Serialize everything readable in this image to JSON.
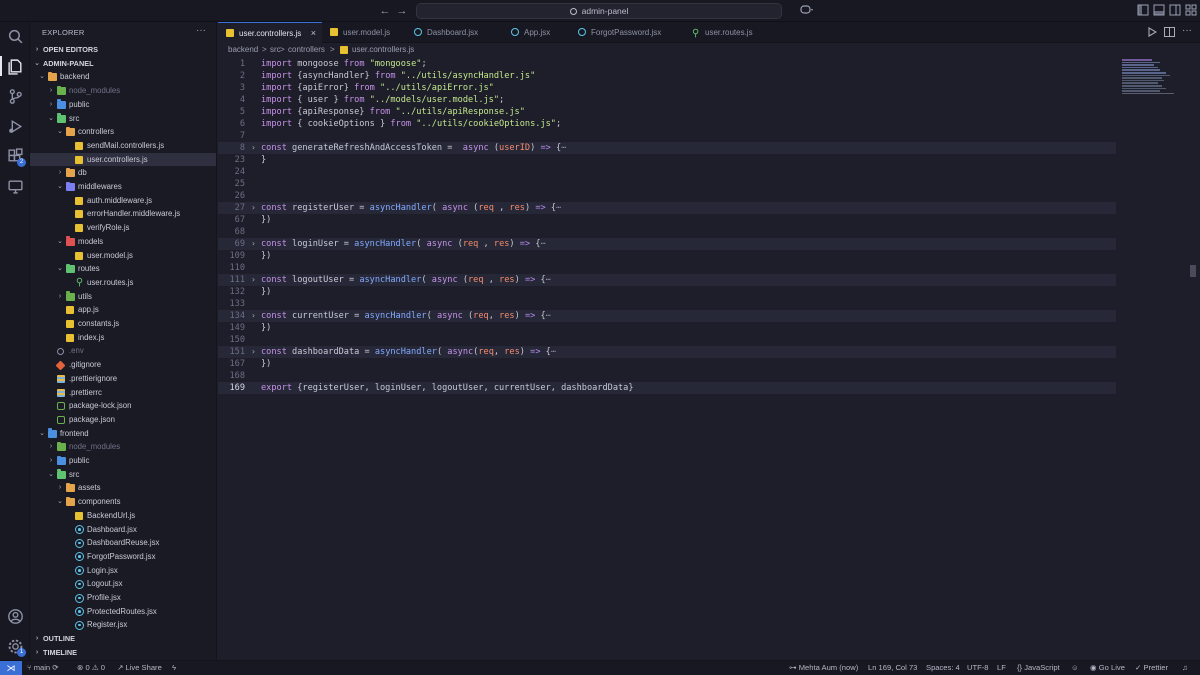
{
  "titlebar": {
    "search_text": "admin-panel",
    "nav_back": "←",
    "nav_forward": "→"
  },
  "explorer": {
    "title": "EXPLORER",
    "more": "···",
    "open_editors": "OPEN EDITORS",
    "root": "ADMIN-PANEL",
    "outline": "OUTLINE",
    "timeline": "TIMELINE",
    "tree": [
      {
        "label": "backend",
        "depth": 0,
        "chev": "v",
        "icon": "folder",
        "color": "#e5a44a"
      },
      {
        "label": "node_modules",
        "depth": 1,
        "chev": ">",
        "icon": "folder",
        "color": "#6ab04c",
        "dim": true
      },
      {
        "label": "public",
        "depth": 1,
        "chev": ">",
        "icon": "folder",
        "color": "#4b8fe0"
      },
      {
        "label": "src",
        "depth": 1,
        "chev": "v",
        "icon": "folder",
        "color": "#5ec270"
      },
      {
        "label": "controllers",
        "depth": 2,
        "chev": "v",
        "icon": "folder",
        "color": "#e5a44a"
      },
      {
        "label": "sendMail.controllers.js",
        "depth": 3,
        "icon": "js"
      },
      {
        "label": "user.controllers.js",
        "depth": 3,
        "icon": "js",
        "selected": true
      },
      {
        "label": "db",
        "depth": 2,
        "chev": ">",
        "icon": "folder",
        "color": "#e5a44a"
      },
      {
        "label": "middlewares",
        "depth": 2,
        "chev": "v",
        "icon": "folder",
        "color": "#7c7ff2"
      },
      {
        "label": "auth.middleware.js",
        "depth": 3,
        "icon": "js"
      },
      {
        "label": "errorHandler.middleware.js",
        "depth": 3,
        "icon": "js"
      },
      {
        "label": "verifyRole.js",
        "depth": 3,
        "icon": "js"
      },
      {
        "label": "models",
        "depth": 2,
        "chev": "v",
        "icon": "folder",
        "color": "#e05252"
      },
      {
        "label": "user.model.js",
        "depth": 3,
        "icon": "js"
      },
      {
        "label": "routes",
        "depth": 2,
        "chev": "v",
        "icon": "folder",
        "color": "#5ec270"
      },
      {
        "label": "user.routes.js",
        "depth": 3,
        "icon": "route"
      },
      {
        "label": "utils",
        "depth": 2,
        "chev": ">",
        "icon": "folder",
        "color": "#6ab04c"
      },
      {
        "label": "app.js",
        "depth": 2,
        "icon": "js"
      },
      {
        "label": "constants.js",
        "depth": 2,
        "icon": "js"
      },
      {
        "label": "index.js",
        "depth": 2,
        "icon": "js"
      },
      {
        "label": ".env",
        "depth": 1,
        "icon": "env",
        "dim": true
      },
      {
        "label": ".gitignore",
        "depth": 1,
        "icon": "git"
      },
      {
        "label": ".prettierignore",
        "depth": 1,
        "icon": "prettier"
      },
      {
        "label": ".prettierrc",
        "depth": 1,
        "icon": "prettier"
      },
      {
        "label": "package-lock.json",
        "depth": 1,
        "icon": "node"
      },
      {
        "label": "package.json",
        "depth": 1,
        "icon": "node"
      },
      {
        "label": "frontend",
        "depth": 0,
        "chev": "v",
        "icon": "folder",
        "color": "#4b8fe0"
      },
      {
        "label": "node_modules",
        "depth": 1,
        "chev": ">",
        "icon": "folder",
        "color": "#6ab04c",
        "dim": true
      },
      {
        "label": "public",
        "depth": 1,
        "chev": ">",
        "icon": "folder",
        "color": "#4b8fe0"
      },
      {
        "label": "src",
        "depth": 1,
        "chev": "v",
        "icon": "folder",
        "color": "#5ec270"
      },
      {
        "label": "assets",
        "depth": 2,
        "chev": ">",
        "icon": "folder",
        "color": "#e5a44a"
      },
      {
        "label": "components",
        "depth": 2,
        "chev": "v",
        "icon": "folder",
        "color": "#e5a44a"
      },
      {
        "label": "BackendUrl.js",
        "depth": 3,
        "icon": "js"
      },
      {
        "label": "Dashboard.jsx",
        "depth": 3,
        "icon": "react"
      },
      {
        "label": "DashboardReuse.jsx",
        "depth": 3,
        "icon": "react"
      },
      {
        "label": "ForgotPassword.jsx",
        "depth": 3,
        "icon": "react"
      },
      {
        "label": "Login.jsx",
        "depth": 3,
        "icon": "react"
      },
      {
        "label": "Logout.jsx",
        "depth": 3,
        "icon": "react"
      },
      {
        "label": "Profile.jsx",
        "depth": 3,
        "icon": "react"
      },
      {
        "label": "ProtectedRoutes.jsx",
        "depth": 3,
        "icon": "react"
      },
      {
        "label": "Register.jsx",
        "depth": 3,
        "icon": "react"
      }
    ]
  },
  "tabs": [
    {
      "label": "user.controllers.js",
      "icon": "js",
      "active": true,
      "close": "×"
    },
    {
      "label": "user.model.js",
      "icon": "js"
    },
    {
      "label": "Dashboard.jsx",
      "icon": "react"
    },
    {
      "label": "App.jsx",
      "icon": "react"
    },
    {
      "label": "ForgotPassword.jsx",
      "icon": "react"
    },
    {
      "label": "user.routes.js",
      "icon": "route"
    }
  ],
  "breadcrumb": [
    "backend",
    ">",
    "src",
    ">",
    "controllers",
    ">",
    "user.controllers.js"
  ],
  "code": [
    {
      "n": "1",
      "t": "import mongoose from \"mongoose\";"
    },
    {
      "n": "2",
      "t": "import {asyncHandler} from \"../utils/asyncHandler.js\""
    },
    {
      "n": "3",
      "t": "import {apiError} from \"../utils/apiError.js\""
    },
    {
      "n": "4",
      "t": "import { user } from \"../models/user.model.js\";"
    },
    {
      "n": "5",
      "t": "import {apiResponse} from \"../utils/apiResponse.js\""
    },
    {
      "n": "6",
      "t": "import { cookieOptions } from \"../utils/cookieOptions.js\";"
    },
    {
      "n": "7",
      "t": ""
    },
    {
      "n": "8",
      "t": "const generateRefreshAndAccessToken =  async (userID) => {⋯",
      "fold": true
    },
    {
      "n": "23",
      "t": "}"
    },
    {
      "n": "24",
      "t": ""
    },
    {
      "n": "25",
      "t": ""
    },
    {
      "n": "26",
      "t": ""
    },
    {
      "n": "27",
      "t": "const registerUser = asyncHandler( async (req , res) => {⋯",
      "fold": true
    },
    {
      "n": "67",
      "t": "})"
    },
    {
      "n": "68",
      "t": ""
    },
    {
      "n": "69",
      "t": "const loginUser = asyncHandler( async (req , res) => {⋯",
      "fold": true
    },
    {
      "n": "109",
      "t": "})"
    },
    {
      "n": "110",
      "t": ""
    },
    {
      "n": "111",
      "t": "const logoutUser = asyncHandler( async (req , res) => {⋯",
      "fold": true
    },
    {
      "n": "132",
      "t": "})"
    },
    {
      "n": "133",
      "t": ""
    },
    {
      "n": "134",
      "t": "const currentUser = asyncHandler( async (req, res) => {⋯",
      "fold": true
    },
    {
      "n": "149",
      "t": "})"
    },
    {
      "n": "150",
      "t": ""
    },
    {
      "n": "151",
      "t": "const dashboardData = asyncHandler( async(req, res) => {⋯",
      "fold": true
    },
    {
      "n": "167",
      "t": "})"
    },
    {
      "n": "168",
      "t": ""
    },
    {
      "n": "169",
      "t": "export {registerUser, loginUser, logoutUser, currentUser, dashboardData}",
      "current": true
    }
  ],
  "statusbar": {
    "branch": "main",
    "problems": "0",
    "warnings": "0",
    "live_share": "Live Share",
    "author": "Mehta Aum (now)",
    "position": "Ln 169, Col 73",
    "spaces": "Spaces: 4",
    "encoding": "UTF-8",
    "eol": "LF",
    "language": "JavaScript",
    "go_live": "Go Live",
    "prettier": "Prettier"
  },
  "activity_badges": {
    "extensions": "2",
    "settings": "1"
  },
  "colors": {
    "accent": "#3a6fd6",
    "background": "#1e1e2a",
    "sidebar": "#1a1a24"
  }
}
